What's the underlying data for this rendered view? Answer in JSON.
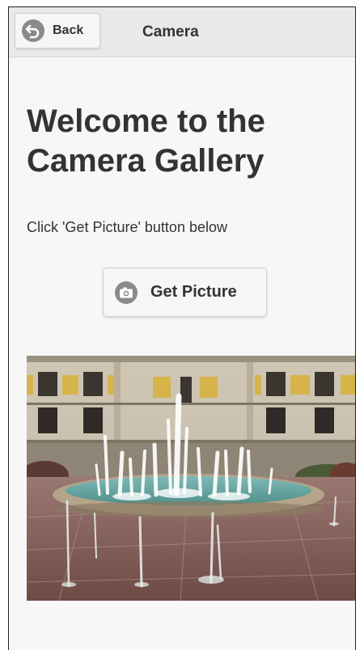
{
  "header": {
    "back_label": "Back",
    "title": "Camera",
    "back_icon": "back-arrow-icon"
  },
  "main": {
    "heading": "Welcome to the Camera Gallery",
    "instructions": "Click 'Get Picture' button below",
    "get_picture_label": "Get Picture",
    "camera_icon": "camera-icon"
  },
  "colors": {
    "header_bg": "#e9e9e9",
    "page_bg": "#f7f7f7",
    "text": "#333333",
    "icon_circle": "#8a8a8a"
  }
}
